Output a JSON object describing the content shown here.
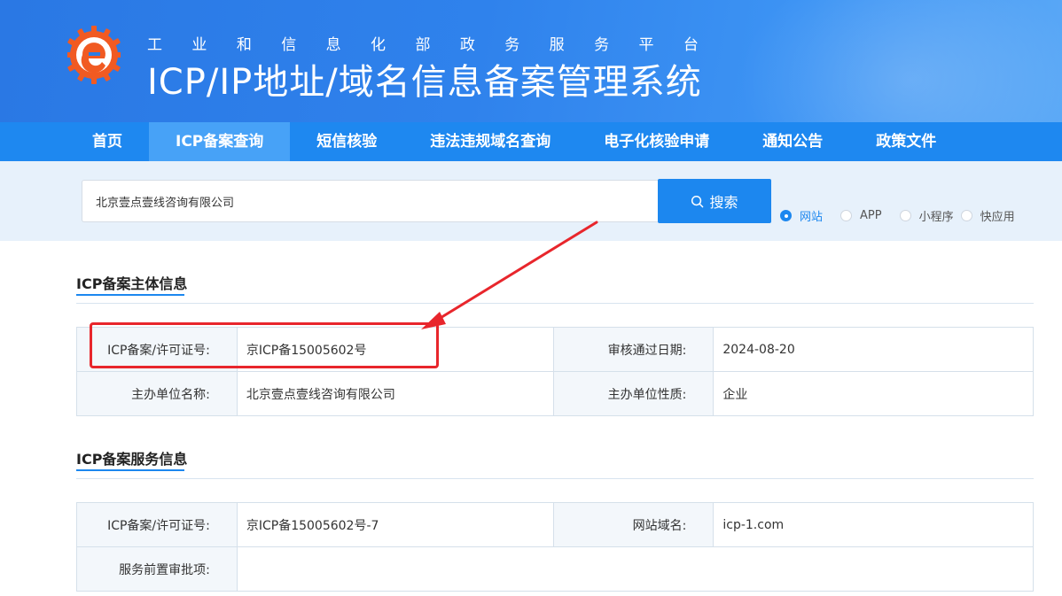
{
  "header": {
    "subtitle_chars": [
      "工",
      "业",
      "和",
      "信",
      "息",
      "化",
      "部",
      "政",
      "务",
      "服",
      "务",
      "平",
      "台"
    ],
    "title": "ICP/IP地址/域名信息备案管理系统"
  },
  "nav": {
    "items": [
      {
        "label": "首页",
        "active": false
      },
      {
        "label": "ICP备案查询",
        "active": true
      },
      {
        "label": "短信核验",
        "active": false
      },
      {
        "label": "违法违规域名查询",
        "active": false
      },
      {
        "label": "电子化核验申请",
        "active": false
      },
      {
        "label": "通知公告",
        "active": false
      },
      {
        "label": "政策文件",
        "active": false
      }
    ]
  },
  "search": {
    "value": "北京壹点壹线咨询有限公司",
    "button_label": "搜索",
    "options": [
      {
        "label": "网站",
        "checked": true
      },
      {
        "label": "APP",
        "checked": false
      },
      {
        "label": "小程序",
        "checked": false
      },
      {
        "label": "快应用",
        "checked": false
      }
    ]
  },
  "subject_info": {
    "title": "ICP备案主体信息",
    "license_label": "ICP备案/许可证号:",
    "license_value": "京ICP备15005602号",
    "approve_date_label": "审核通过日期:",
    "approve_date_value": "2024-08-20",
    "org_name_label": "主办单位名称:",
    "org_name_value": "北京壹点壹线咨询有限公司",
    "org_type_label": "主办单位性质:",
    "org_type_value": "企业"
  },
  "service_info": {
    "title": "ICP备案服务信息",
    "license_label": "ICP备案/许可证号:",
    "license_value": "京ICP备15005602号-7",
    "domain_label": "网站域名:",
    "domain_value": "icp-1.com",
    "pre_approval_label": "服务前置审批项:",
    "pre_approval_value": ""
  },
  "colors": {
    "brand_blue": "#1c87ef",
    "annotation_red": "#e8262c"
  }
}
